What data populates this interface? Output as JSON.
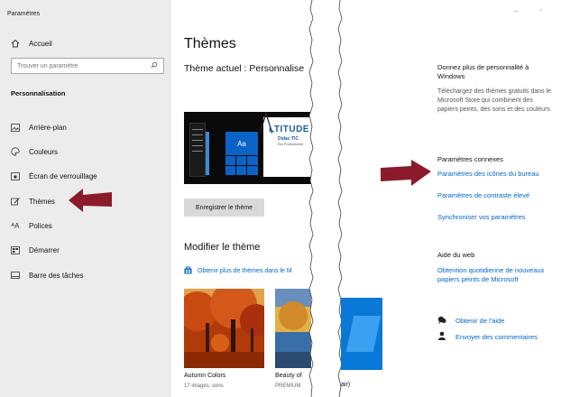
{
  "window_title": "Paramètres",
  "sidebar": {
    "home_label": "Accueil",
    "search_placeholder": "Trouver un paramètre",
    "section_label": "Personnalisation",
    "items": [
      {
        "label": "Arrière-plan",
        "icon": "image-icon"
      },
      {
        "label": "Couleurs",
        "icon": "palette-icon"
      },
      {
        "label": "Écran de verrouillage",
        "icon": "lock-screen-icon"
      },
      {
        "label": "Thèmes",
        "icon": "themes-icon"
      },
      {
        "label": "Polices",
        "icon": "fonts-icon"
      },
      {
        "label": "Démarrer",
        "icon": "start-icon"
      },
      {
        "label": "Barre des tâches",
        "icon": "taskbar-icon"
      }
    ]
  },
  "main": {
    "title": "Thèmes",
    "current_theme": "Thème actuel : Personnalise",
    "preview_brand": "LTITUDE",
    "preview_brand2": "Didac TIC",
    "preview_brand3": "Éco Professionnel",
    "preview_tile_label": "Aa",
    "save_button": "Enregistrer le thème",
    "modify_heading": "Modifier le thème",
    "store_link": "Obtenir plus de thèmes dans le M",
    "themes": [
      {
        "name": "Autumn Colors",
        "sub": "17 images, sons"
      },
      {
        "name": "Beauty of",
        "sub": "PREMIUM"
      }
    ],
    "partial_text": "air)"
  },
  "right": {
    "promo_heading": "Donnez plus de personnalité à Windows",
    "promo_text": "Téléchargez des thèmes gratuits dans le Microsoft Store qui combinent des papiers peints, des sons et des couleurs",
    "related_heading": "Paramètres connexes",
    "related_links": [
      "Paramètres des icônes du bureau",
      "Paramètres de contraste élevé",
      "Synchroniser vos paramètres"
    ],
    "web_heading": "Aide du web",
    "web_link": "Obtention quotidienne de nouveaux papiers peints de Microsoft",
    "help_link": "Obtenir de l'aide",
    "feedback_link": "Envoyer des commentaires"
  },
  "colors": {
    "accent": "#0066cc",
    "arrow": "#8b1a2b",
    "sidebar_bg": "#ececec"
  }
}
